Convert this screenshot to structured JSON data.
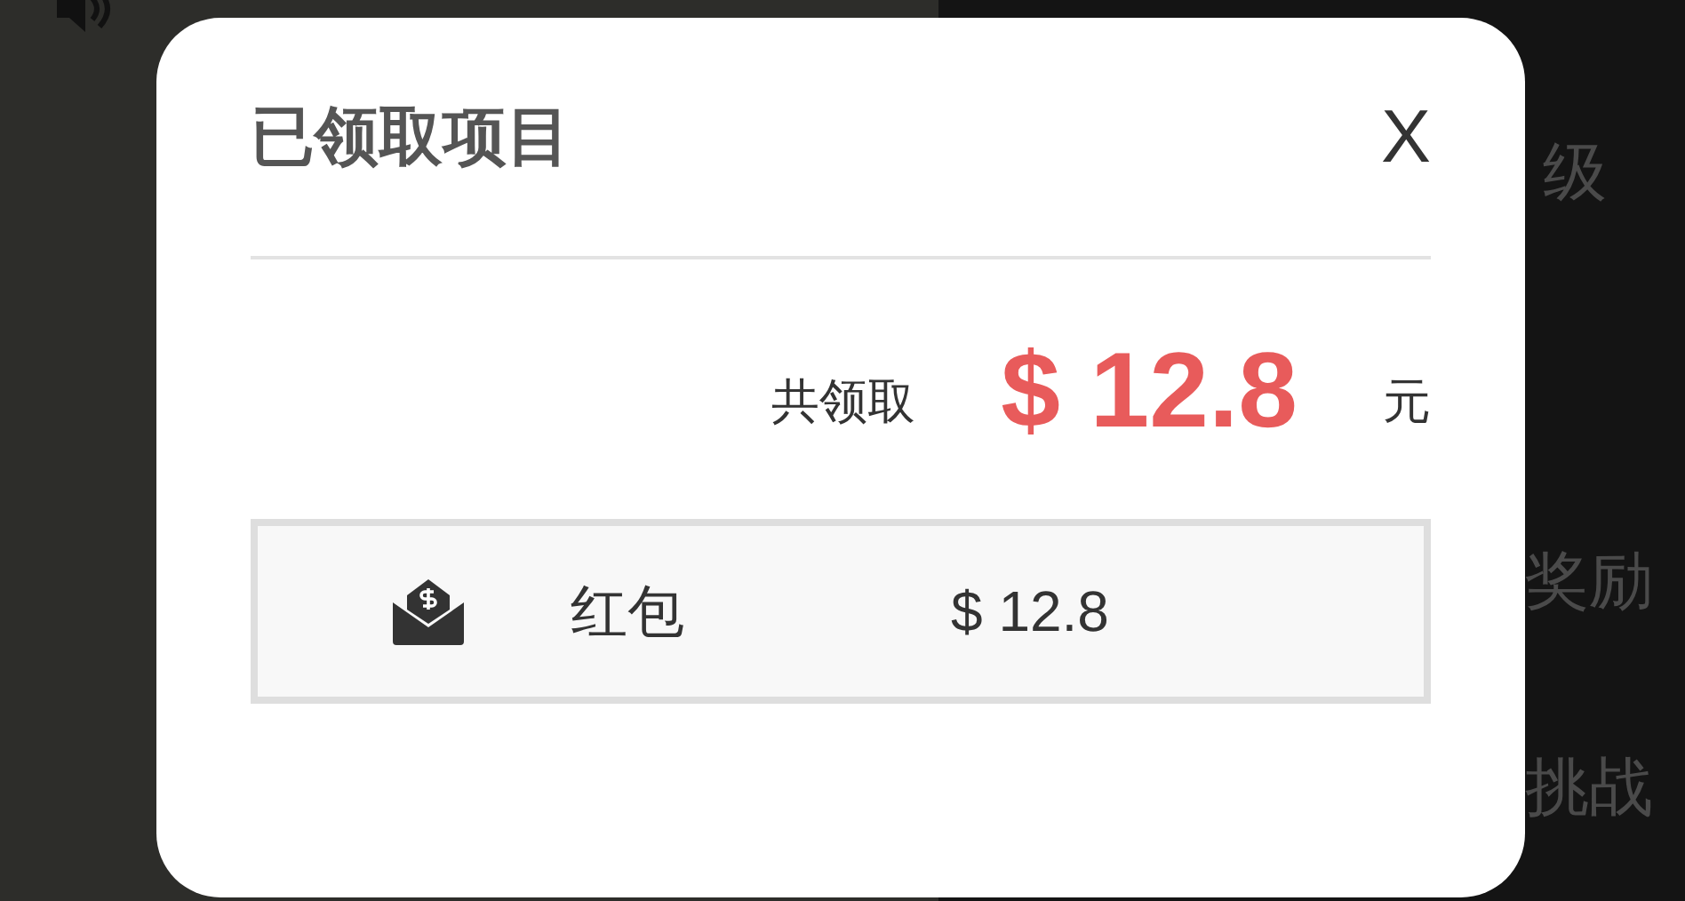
{
  "background": {
    "labels": [
      "级",
      "奖励",
      "挑战"
    ]
  },
  "dialog": {
    "title": "已领取项目",
    "close": "X",
    "total_label": "共领取",
    "total_amount": "$ 12.8",
    "unit": "元",
    "items": [
      {
        "kind": "red_packet",
        "name": "红包",
        "amount": "$ 12.8"
      }
    ]
  }
}
